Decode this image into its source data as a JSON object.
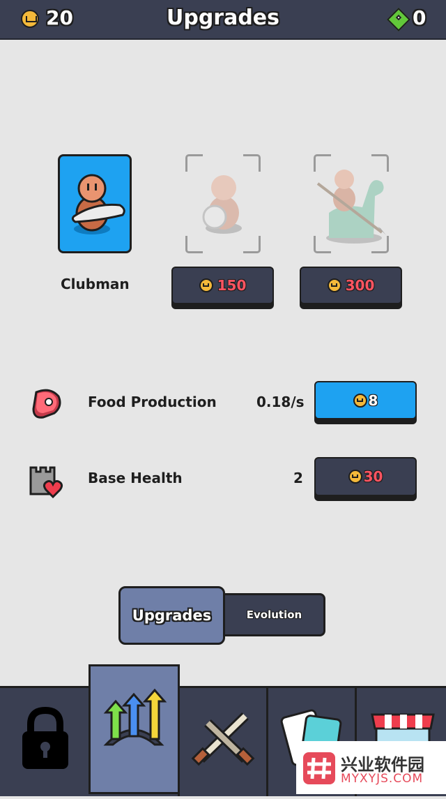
{
  "header": {
    "coins": "20",
    "title": "Upgrades",
    "gems": "0"
  },
  "units": [
    {
      "name": "Clubman",
      "unlocked": true
    },
    {
      "price": "150",
      "unlocked": false
    },
    {
      "price": "300",
      "unlocked": false
    }
  ],
  "upgrades": [
    {
      "name": "Food Production",
      "value": "0.18/s",
      "cost": "8",
      "icon": "meat-icon",
      "affordable": true
    },
    {
      "name": "Base Health",
      "value": "2",
      "cost": "30",
      "icon": "castle-heart-icon",
      "affordable": false
    }
  ],
  "tabs": {
    "active": "Upgrades",
    "inactive": "Evolution"
  },
  "navbar": {
    "items": [
      "lock-icon",
      "upgrade-arrows-icon",
      "crossed-swords-icon",
      "cards-icon",
      "shop-icon"
    ],
    "active_index": 1
  },
  "watermark": {
    "title": "兴业软件园",
    "subtitle": "MYXYJS.COM"
  },
  "colors": {
    "accent_blue": "#1ea2f1",
    "panel_dark": "#3a3f52",
    "coin_gold": "#f4b93a",
    "price_red": "#ff5461"
  }
}
